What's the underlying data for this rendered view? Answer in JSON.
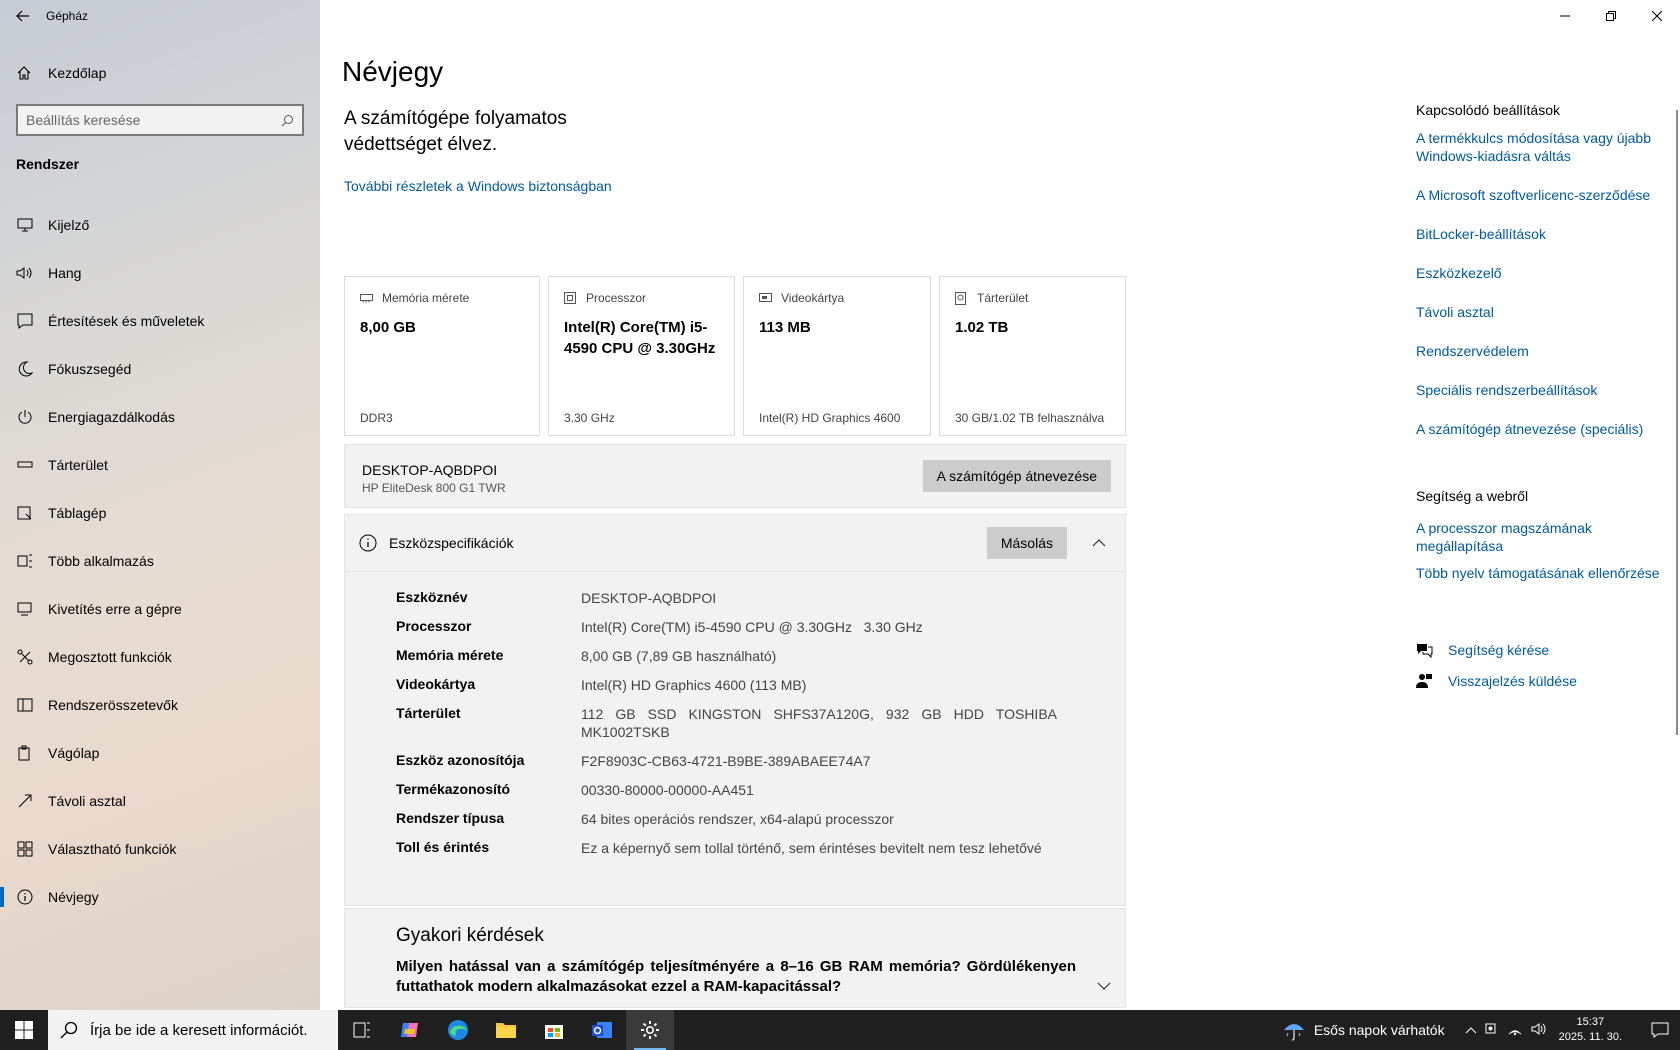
{
  "window": {
    "title": "Gépház"
  },
  "sidebar": {
    "home_label": "Kezdőlap",
    "search_placeholder": "Beállítás keresése",
    "section_title": "Rendszer",
    "items": [
      {
        "label": "Kijelző",
        "icon": "monitor-icon"
      },
      {
        "label": "Hang",
        "icon": "speaker-icon"
      },
      {
        "label": "Értesítések és műveletek",
        "icon": "notification-icon"
      },
      {
        "label": "Fókuszsegéd",
        "icon": "moon-icon"
      },
      {
        "label": "Energiagazdálkodás",
        "icon": "power-icon"
      },
      {
        "label": "Tárterület",
        "icon": "storage-icon"
      },
      {
        "label": "Táblagép",
        "icon": "tablet-icon"
      },
      {
        "label": "Több alkalmazás",
        "icon": "multitasking-icon"
      },
      {
        "label": "Kivetítés erre a gépre",
        "icon": "projecting-icon"
      },
      {
        "label": "Megosztott funkciók",
        "icon": "shared-icon"
      },
      {
        "label": "Rendszerösszetevők",
        "icon": "components-icon"
      },
      {
        "label": "Vágólap",
        "icon": "clipboard-icon"
      },
      {
        "label": "Távoli asztal",
        "icon": "remote-desktop-icon"
      },
      {
        "label": "Választható funkciók",
        "icon": "optional-features-icon"
      },
      {
        "label": "Névjegy",
        "icon": "info-icon",
        "active": true
      }
    ]
  },
  "main": {
    "title": "Névjegy",
    "protection_text": "A számítógépe folyamatos védettséget élvez.",
    "security_link": "További részletek a Windows biztonságban",
    "cards": [
      {
        "header": "Memória mérete",
        "value": "8,00 GB",
        "sub": "DDR3",
        "icon": "memory-icon"
      },
      {
        "header": "Processzor",
        "value": "Intel(R) Core(TM) i5-4590 CPU @ 3.30GHz",
        "sub": "3.30 GHz",
        "icon": "cpu-icon"
      },
      {
        "header": "Videokártya",
        "value": "113 MB",
        "sub": "Intel(R) HD Graphics 4600",
        "icon": "gpu-icon"
      },
      {
        "header": "Tárterület",
        "value": "1.02 TB",
        "sub": "30 GB/1.02 TB felhasználva",
        "icon": "disk-icon"
      }
    ],
    "device": {
      "name": "DESKTOP-AQBDPOI",
      "model": "HP EliteDesk 800 G1 TWR",
      "rename_button": "A számítógép átnevezése"
    },
    "specs": {
      "title": "Eszközspecifikációk",
      "copy_button": "Másolás",
      "rows": [
        {
          "key": "Eszköznév",
          "value": "DESKTOP-AQBDPOI"
        },
        {
          "key": "Processzor",
          "value": "Intel(R) Core(TM) i5-4590 CPU @ 3.30GHz   3.30 GHz"
        },
        {
          "key": "Memória mérete",
          "value": "8,00 GB (7,89 GB használható)"
        },
        {
          "key": "Videokártya",
          "value": "Intel(R) HD Graphics 4600 (113 MB)"
        },
        {
          "key": "Tárterület",
          "value": "112 GB SSD KINGSTON SHFS37A120G, 932 GB HDD TOSHIBA MK1002TSKB"
        },
        {
          "key": "Eszköz azonosítója",
          "value": "F2F8903C-CB63-4721-B9BE-389ABAEE74A7"
        },
        {
          "key": "Termékazonosító",
          "value": "00330-80000-00000-AA451"
        },
        {
          "key": "Rendszer típusa",
          "value": "64 bites operációs rendszer, x64-alapú processzor"
        },
        {
          "key": "Toll és érintés",
          "value": "Ez a képernyő sem tollal történő, sem érintéses bevitelt nem tesz lehetővé"
        }
      ]
    },
    "faq": {
      "title": "Gyakori kérdések",
      "question": "Milyen hatással van a számítógép teljesítményére a 8–16 GB RAM memória? Gördülékenyen futtathatok modern alkalmazásokat ezzel a RAM-kapacitással?"
    }
  },
  "related": {
    "title": "Kapcsolódó beállítások",
    "links": [
      "A termékkulcs módosítása vagy újabb Windows-kiadásra váltás",
      "A Microsoft szoftverlicenc-szerződése",
      "BitLocker-beállítások",
      "Eszközkezelő",
      "Távoli asztal",
      "Rendszervédelem",
      "Speciális rendszerbeállítások",
      "A számítógép átnevezése (speciális)"
    ]
  },
  "help": {
    "title": "Segítség a webről",
    "links": [
      "A processzor magszámának megállapítása",
      "Több nyelv támogatásának ellenőrzése"
    ]
  },
  "support": {
    "get_help": "Segítség kérése",
    "feedback": "Visszajelzés küldése"
  },
  "taskbar": {
    "search_placeholder": "Írja be ide a keresett információt.",
    "weather": "Esős napok várhatók",
    "time": "15:37",
    "date": "2025. 11. 30."
  },
  "colors": {
    "accent": "#0067c0",
    "link": "#005a9e",
    "taskbar": "#1f1f1f"
  }
}
